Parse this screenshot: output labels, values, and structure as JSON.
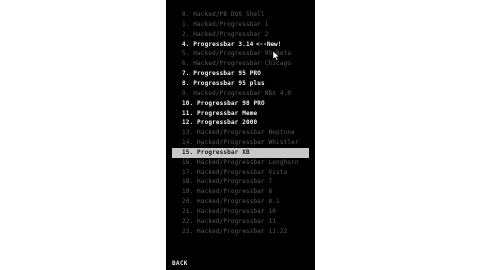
{
  "menu": {
    "items": [
      {
        "label": "0. Hacked/PB DOS Shell",
        "style": "dim"
      },
      {
        "label": "1. Hacked/Progressbar 1",
        "style": "dim"
      },
      {
        "label": "2. Hacked/Progressbar 2",
        "style": "dim"
      },
      {
        "label": "4. Progressbar 3.14",
        "style": "bright"
      },
      {
        "label": "5. Hacked/Progressbar 95 Beta",
        "style": "dim"
      },
      {
        "label": "6. Hacked/Progressbar Chicago",
        "style": "dim"
      },
      {
        "label": "7. Progressbar 95 PRO",
        "style": "bright"
      },
      {
        "label": "8. Progressbar 95 plus",
        "style": "bright"
      },
      {
        "label": "9. Hacked/Progressbar NBX 4.0",
        "style": "dim"
      },
      {
        "label": "10. Progressbar 98 PRO",
        "style": "bright"
      },
      {
        "label": "11. Progressbar Meme",
        "style": "bright"
      },
      {
        "label": "12. Progressbar 2000",
        "style": "bright"
      },
      {
        "label": "13. Hacked/Progressbar Neptune",
        "style": "dim"
      },
      {
        "label": "14. Hacked/Progressbar Whistler",
        "style": "dim"
      },
      {
        "label": "15. Progressbar XB",
        "style": "selected"
      },
      {
        "label": "16. Hacked/Progressbar Longhorn",
        "style": "dim"
      },
      {
        "label": "17. Hacked/Progressbar Vista",
        "style": "dim"
      },
      {
        "label": "18. Hacked/Progressbar 7",
        "style": "dim"
      },
      {
        "label": "19. Hacked/Progressbar 8",
        "style": "dim"
      },
      {
        "label": "20. Hacked/Progressbar 8.1",
        "style": "dim"
      },
      {
        "label": "21. Hacked/Progressbar 10",
        "style": "dim"
      },
      {
        "label": "22. Hacked/Progressbar 11",
        "style": "dim"
      },
      {
        "label": "23. Hacked/Progressbar 11.22",
        "style": "dim"
      }
    ],
    "new_tag": "<--New!"
  },
  "footer": {
    "back_label": "BACK"
  }
}
